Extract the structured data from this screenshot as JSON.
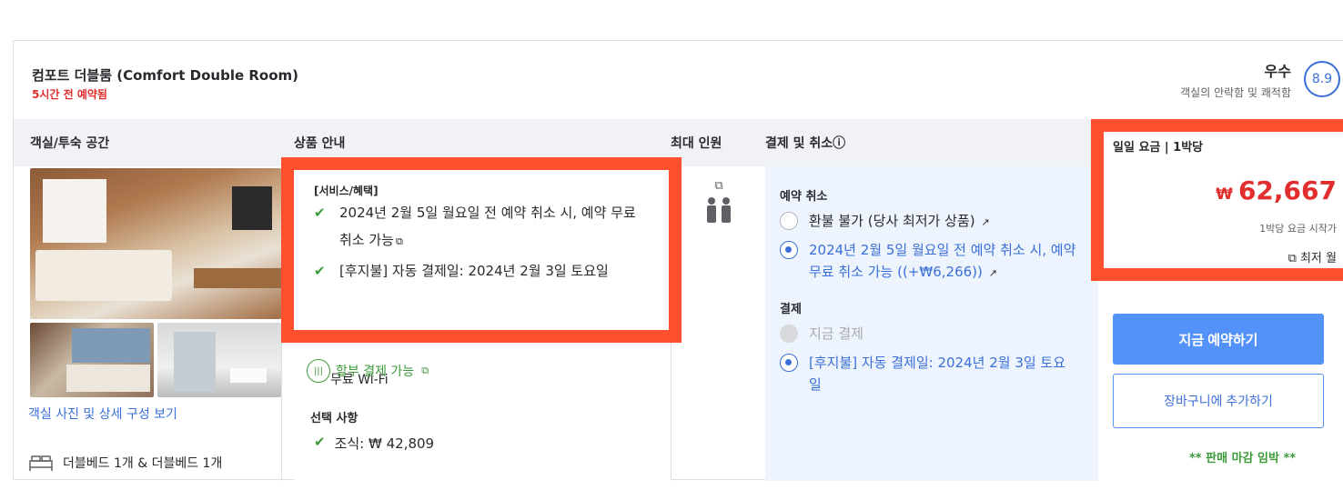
{
  "room": {
    "title": "컴포트 더블룸 (Comfort Double Room)",
    "booked_recently": "5시간 전 예약됨",
    "rating_word": "우수",
    "rating_sub": "객실의 안락함 및 쾌적함",
    "score": "8.9"
  },
  "columns": {
    "room": "객실/투숙 공간",
    "benefits": "상품 안내",
    "occupancy": "최대 인원",
    "payment": "결제 및 취소ⓘ",
    "price": "일일 요금 | 1박당"
  },
  "room_info": {
    "photos_link": "객실 사진 및 상세 구성 보기",
    "bed": "더블베드 1개 & 더블베드 1개"
  },
  "benefits": {
    "title": "[서비스/혜택]",
    "items": [
      {
        "text": "2024년 2월 5일 월요일 전 예약 취소 시, 예약 무료 취소 가능",
        "ext": "⧉"
      },
      {
        "text": "[후지불] 자동 결제일: 2024년 2월 3일 토요일"
      }
    ],
    "hidden_partial": "무료 Wi-Fi",
    "installment": "할부 결제 가능",
    "installment_icon": "⧉",
    "options_title": "선택 사항",
    "options": [
      {
        "label": "조식: ",
        "price": "₩ 42,809"
      }
    ]
  },
  "occupancy": {
    "ext_icon": "⧉",
    "people_icon": "👥"
  },
  "payment": {
    "cancel_title": "예약 취소",
    "cancel_options": [
      {
        "label": "환불 불가 (당사 최저가 상품)",
        "ext": "↗",
        "selected": false
      },
      {
        "label": "2024년 2월 5일 월요일 전 예약 취소 시, 예약 무료 취소 가능 ((+₩6,266))",
        "ext": "↗",
        "selected": true
      }
    ],
    "pay_title": "결제",
    "pay_options": [
      {
        "label": "지금 결제",
        "disabled": true
      },
      {
        "label": "[후지불] 자동 결제일: 2024년 2월 3일 토요일",
        "selected": true
      }
    ]
  },
  "price": {
    "currency": "₩",
    "value": "62,667",
    "sub": "1박당 요금 시작가",
    "lowest": "⧉ 최저 월",
    "book_button": "지금 예약하기",
    "cart_button": "장바구니에 추가하기",
    "urgent": "** 판매 마감 임박 **"
  },
  "colors": {
    "accent": "#5392f9",
    "red": "#e12d2d",
    "green": "#3d9a3a",
    "highlight": "#ff4f2d"
  }
}
